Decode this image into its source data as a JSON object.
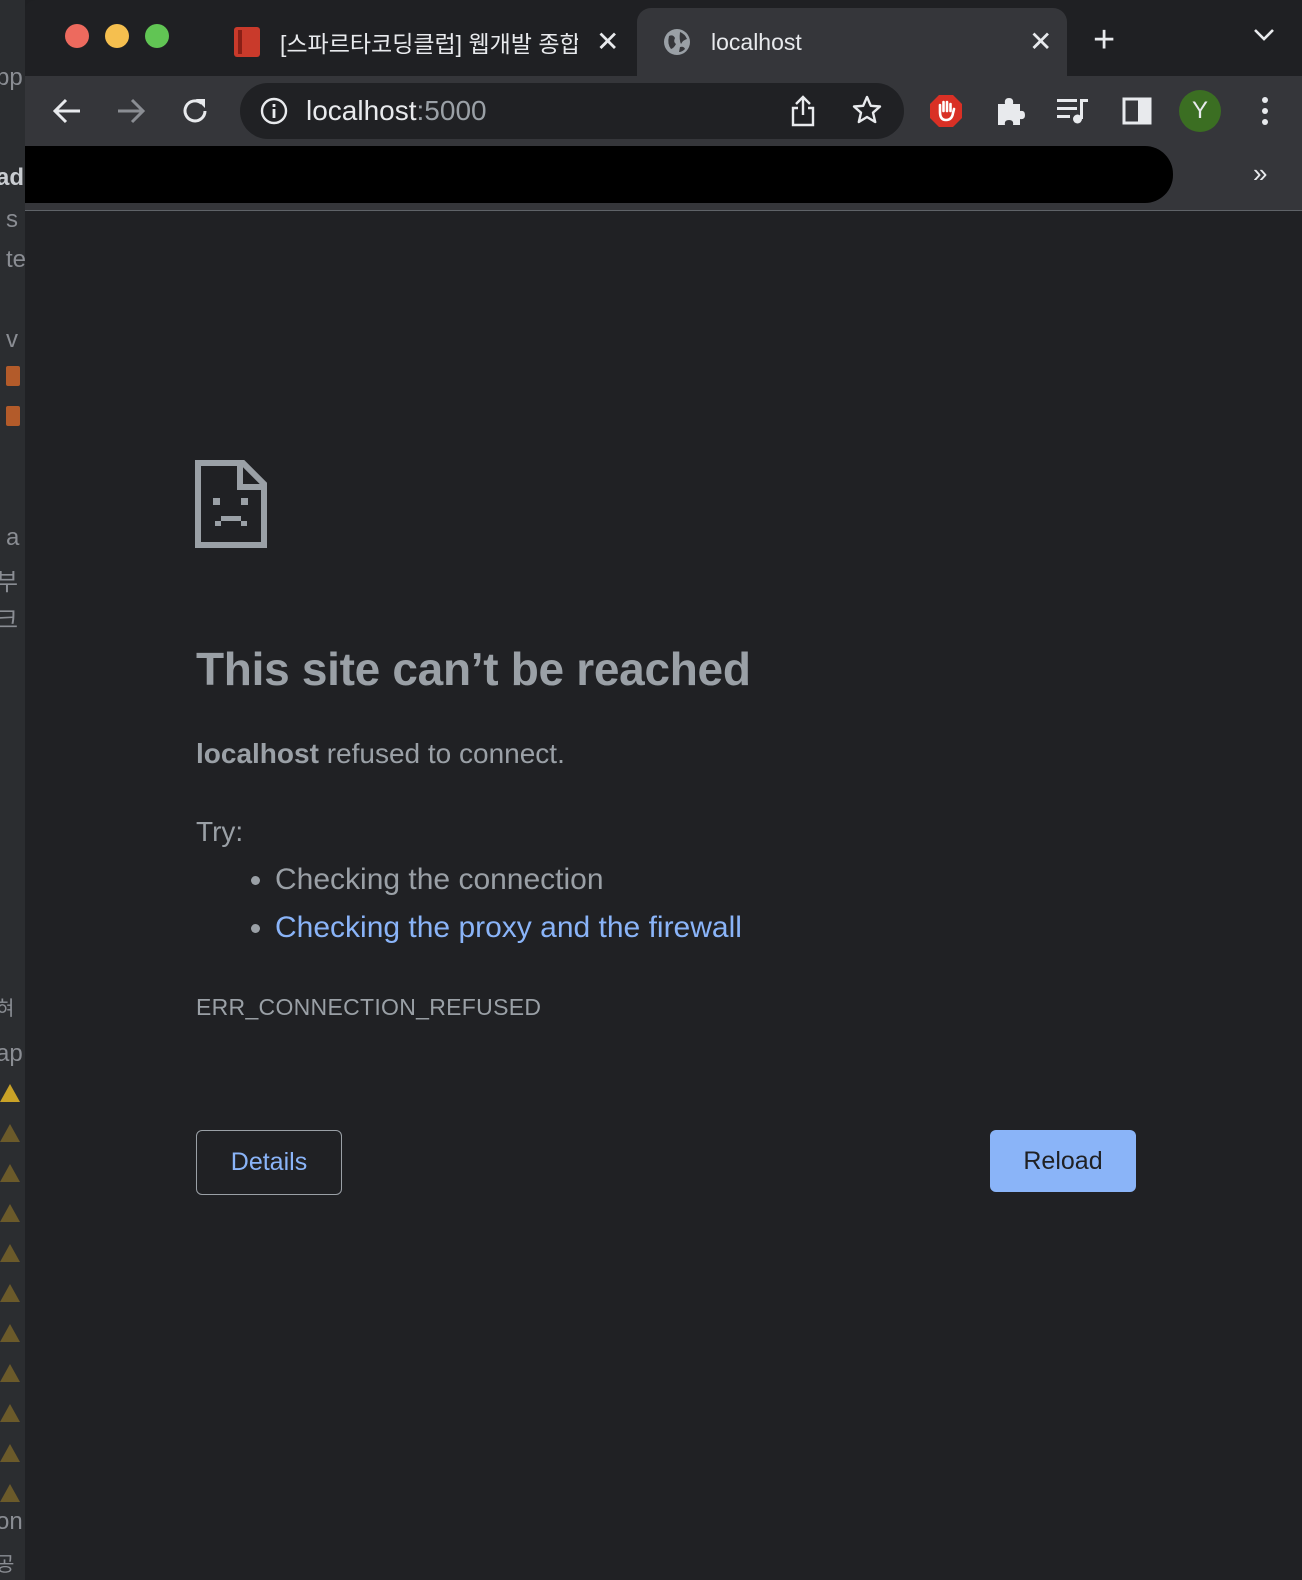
{
  "ide": {
    "fragments": [
      "pp",
      "ad",
      "s",
      "te",
      "v",
      "a",
      "부",
      "크",
      "혀",
      "ap",
      "on",
      "공"
    ]
  },
  "tabs": [
    {
      "title": "[스파르타코딩클럽] 웹개발 종합반",
      "icon": "book-icon",
      "active": false
    },
    {
      "title": "localhost",
      "icon": "globe-icon",
      "active": true
    }
  ],
  "toolbar": {
    "url_host": "localhost",
    "url_port": ":5000",
    "profile_initial": "Y"
  },
  "bookmarks": {
    "more": "»"
  },
  "error": {
    "title": "This site can’t be reached",
    "host": "localhost",
    "desc_rest": " refused to connect.",
    "try_label": "Try:",
    "suggestions": [
      "Checking the connection",
      "Checking the proxy and the firewall"
    ],
    "code": "ERR_CONNECTION_REFUSED",
    "details_label": "Details",
    "reload_label": "Reload"
  },
  "colors": {
    "background": "#202124",
    "chrome": "#35363a",
    "text_secondary": "#9aa0a6",
    "link": "#8ab4f8",
    "profile": "#3b6e22"
  }
}
